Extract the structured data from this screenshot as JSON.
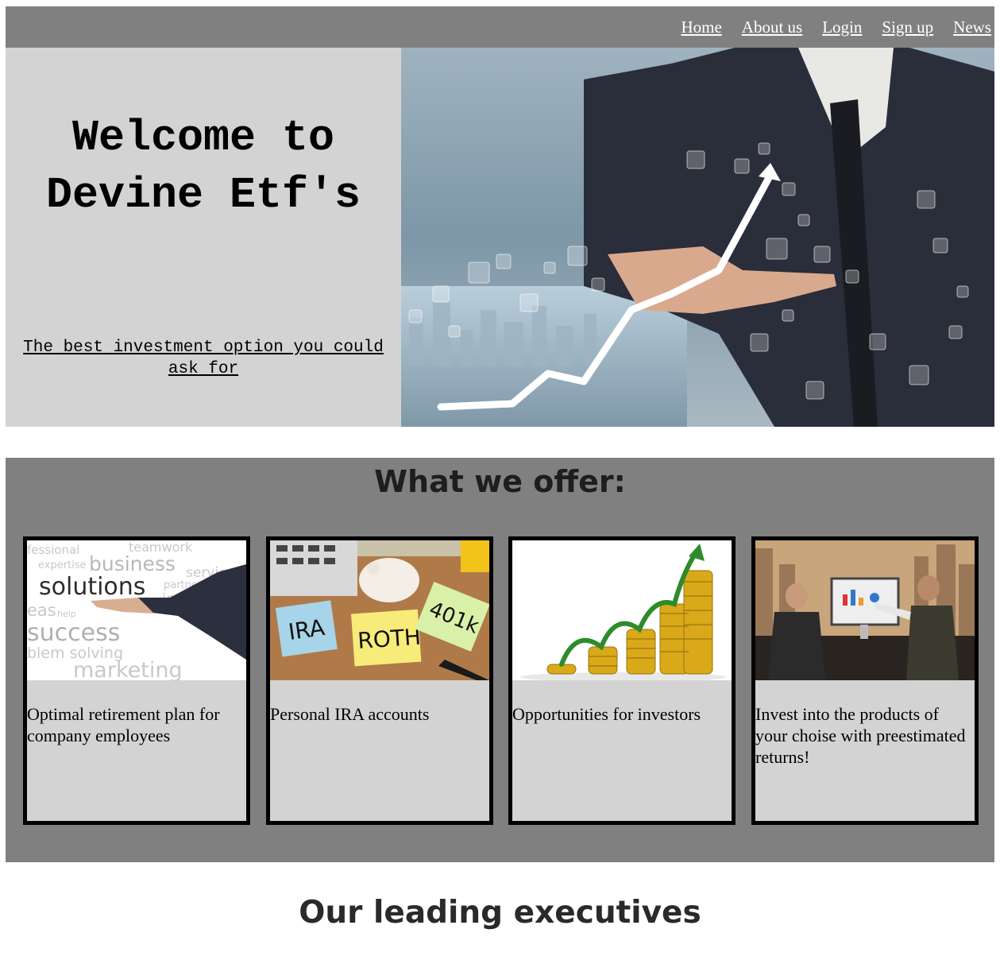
{
  "nav": {
    "items": [
      {
        "label": "Home"
      },
      {
        "label": "About us"
      },
      {
        "label": "Login"
      },
      {
        "label": "Sign up"
      },
      {
        "label": "News"
      }
    ]
  },
  "hero": {
    "title_line1": "Welcome to",
    "title_line2": "Devine Etf's",
    "subtitle": "The best investment option you could ask for"
  },
  "offer": {
    "title": "What we offer:",
    "cards": [
      {
        "text": "Optimal retirement plan for company employees",
        "image_words": [
          "fessional",
          "teamwork",
          "expertise",
          "business",
          "service",
          "solutions",
          "partnership",
          "innovatio",
          "eas",
          "help",
          "success",
          "blem solving",
          "marketing"
        ]
      },
      {
        "text": "Personal IRA accounts",
        "image_notes": [
          "IRA",
          "ROTH",
          "401k"
        ]
      },
      {
        "text": "Opportunities for investors"
      },
      {
        "text": "Invest into the products of your choise with preestimated returns!"
      }
    ]
  },
  "executives": {
    "title": "Our leading executives"
  },
  "colors": {
    "navbar": "#808080",
    "hero_panel": "#d3d3d3",
    "offer_bg": "#808080",
    "card_bg": "#d3d3d3"
  }
}
